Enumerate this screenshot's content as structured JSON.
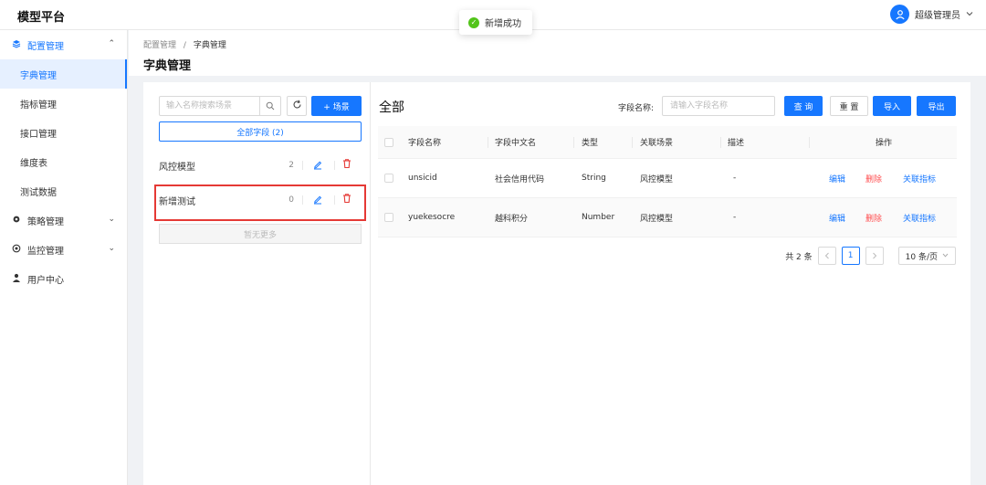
{
  "app": {
    "title": "模型平台"
  },
  "user": {
    "name": "超级管理员"
  },
  "toast": {
    "message": "新增成功"
  },
  "sidebar": {
    "groups": [
      {
        "label": "配置管理",
        "icon": "layers-icon",
        "chevron": "⌃",
        "items": [
          {
            "label": "字典管理"
          },
          {
            "label": "指标管理"
          },
          {
            "label": "接口管理"
          },
          {
            "label": "维度表"
          },
          {
            "label": "测试数据"
          }
        ]
      },
      {
        "label": "策略管理",
        "icon": "gear-icon",
        "chevron": "⌄"
      },
      {
        "label": "监控管理",
        "icon": "monitor-icon",
        "chevron": "⌄"
      },
      {
        "label": "用户中心",
        "icon": "user-icon"
      }
    ]
  },
  "breadcrumb": {
    "parent": "配置管理",
    "separator": "/",
    "current": "字典管理"
  },
  "page": {
    "title": "字典管理"
  },
  "left_panel": {
    "search_placeholder": "输入名称搜索场景",
    "add_scene_label": "+ 场景",
    "all_fields_label": "全部字段 (2)",
    "scenes": [
      {
        "name": "风控模型",
        "count": "2"
      },
      {
        "name": "新增测试",
        "count": "0"
      }
    ],
    "no_more_label": "暂无更多"
  },
  "right_panel": {
    "title": "全部",
    "field_name_label": "字段名称:",
    "field_name_placeholder": "请输入字段名称",
    "query_label": "查 询",
    "reset_label": "重 置",
    "import_label": "导入",
    "export_label": "导出",
    "table": {
      "headers": [
        "字段名称",
        "字段中文名",
        "类型",
        "关联场景",
        "描述",
        "操作"
      ],
      "rows": [
        {
          "field": "unsicid",
          "cn_name": "社会信用代码",
          "type": "String",
          "scene": "风控模型",
          "desc": "-",
          "edit": "编辑",
          "delete": "删除",
          "link": "关联指标"
        },
        {
          "field": "yuekesocre",
          "cn_name": "越科积分",
          "type": "Number",
          "scene": "风控模型",
          "desc": "-",
          "edit": "编辑",
          "delete": "删除",
          "link": "关联指标"
        }
      ]
    },
    "pagination": {
      "total_text": "共 2 条",
      "current_page": "1",
      "page_size": "10 条/页"
    }
  },
  "colors": {
    "primary": "#1677ff",
    "danger": "#ff4d4f",
    "success": "#52c41a",
    "highlight_border": "#e53935"
  }
}
